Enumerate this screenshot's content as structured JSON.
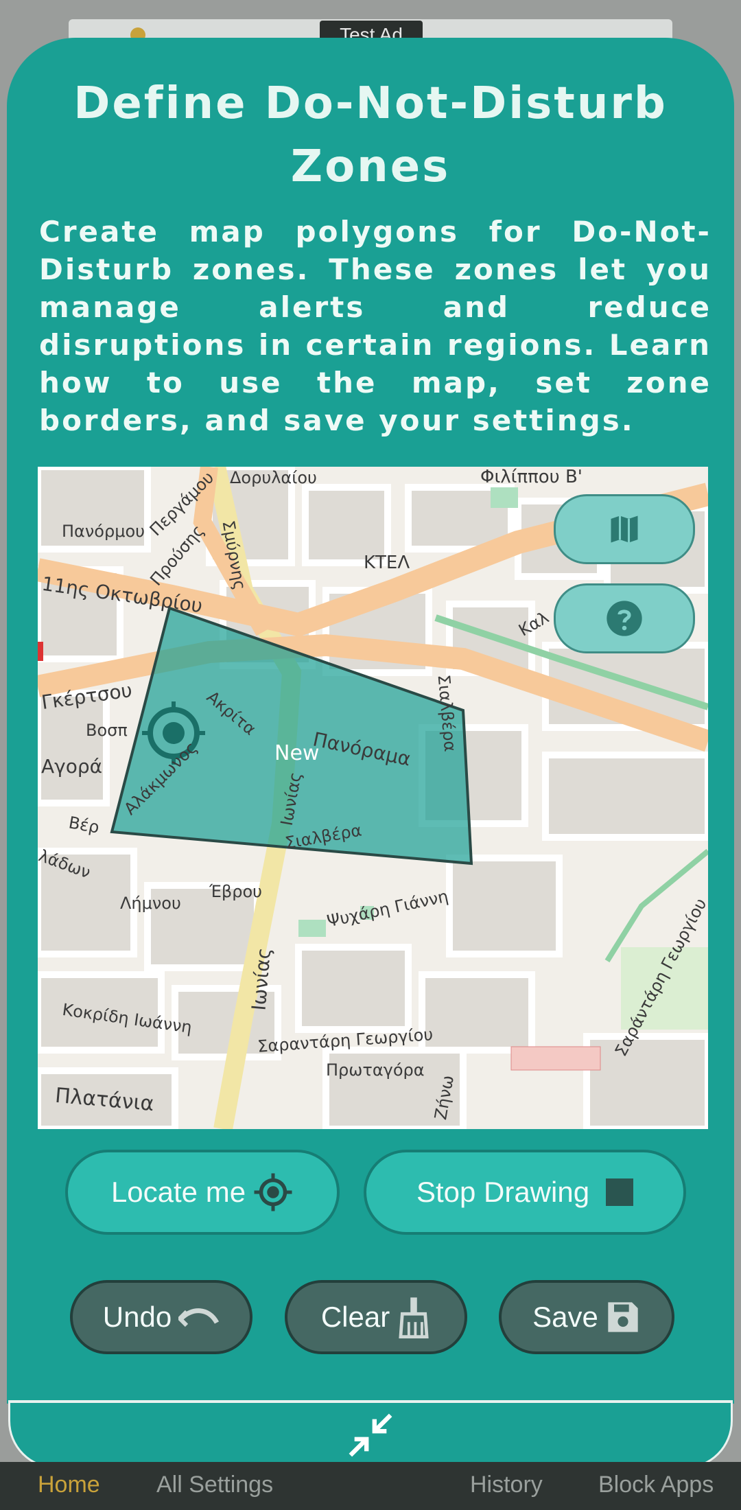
{
  "ad": {
    "label": "Test Ad"
  },
  "sheet": {
    "title": "Define Do-Not-Disturb Zones",
    "description": "Create map polygons for Do-Not-Disturb zones. These zones let you manage alerts and reduce disruptions in certain regions. Learn how to use the map, set zone borders, and save your settings."
  },
  "map": {
    "zone_label": "New",
    "streets": [
      "Φιλίππου Β'",
      "Δορυλαίου",
      "Πανόρμου",
      "Περγάμου",
      "Προύσης",
      "Σμύρνης",
      "ΚΤΕΛ",
      "11ης Οκτωβρίου",
      "Καλ",
      "Γκέρτσου",
      "Ακρίτα",
      "Βοσπ",
      "Αγορά",
      "Αλάκμωνος",
      "Πανόραμα",
      "Σιαλβέρα",
      "Σιαλβέρα",
      "Ιωνίας",
      "Βέρ",
      "λάδων",
      "Λήμνου",
      "Έβρου",
      "Ψυχάρη Γιάννη",
      "Σαράντάρη Γεωργίου",
      "Κοκρίδη Ιωάννη",
      "Σαραντάρη Γεωργίου",
      "Πρωταγόρα",
      "Πλατάνια",
      "Ζήνω",
      "Ιωνίας"
    ],
    "layers_icon": "map-icon",
    "help_icon": "help-icon"
  },
  "actions": {
    "locate_label": "Locate me",
    "stop_label": "Stop Drawing",
    "undo_label": "Undo",
    "clear_label": "Clear",
    "save_label": "Save"
  },
  "nav": {
    "home": "Home",
    "all_settings": "All Settings",
    "history": "History",
    "block_apps": "Block Apps"
  },
  "colors": {
    "sheet": "#1aa094",
    "zone_fill": "#1aa094",
    "dark_button": "#456863",
    "light_button": "#2dbcaf"
  }
}
